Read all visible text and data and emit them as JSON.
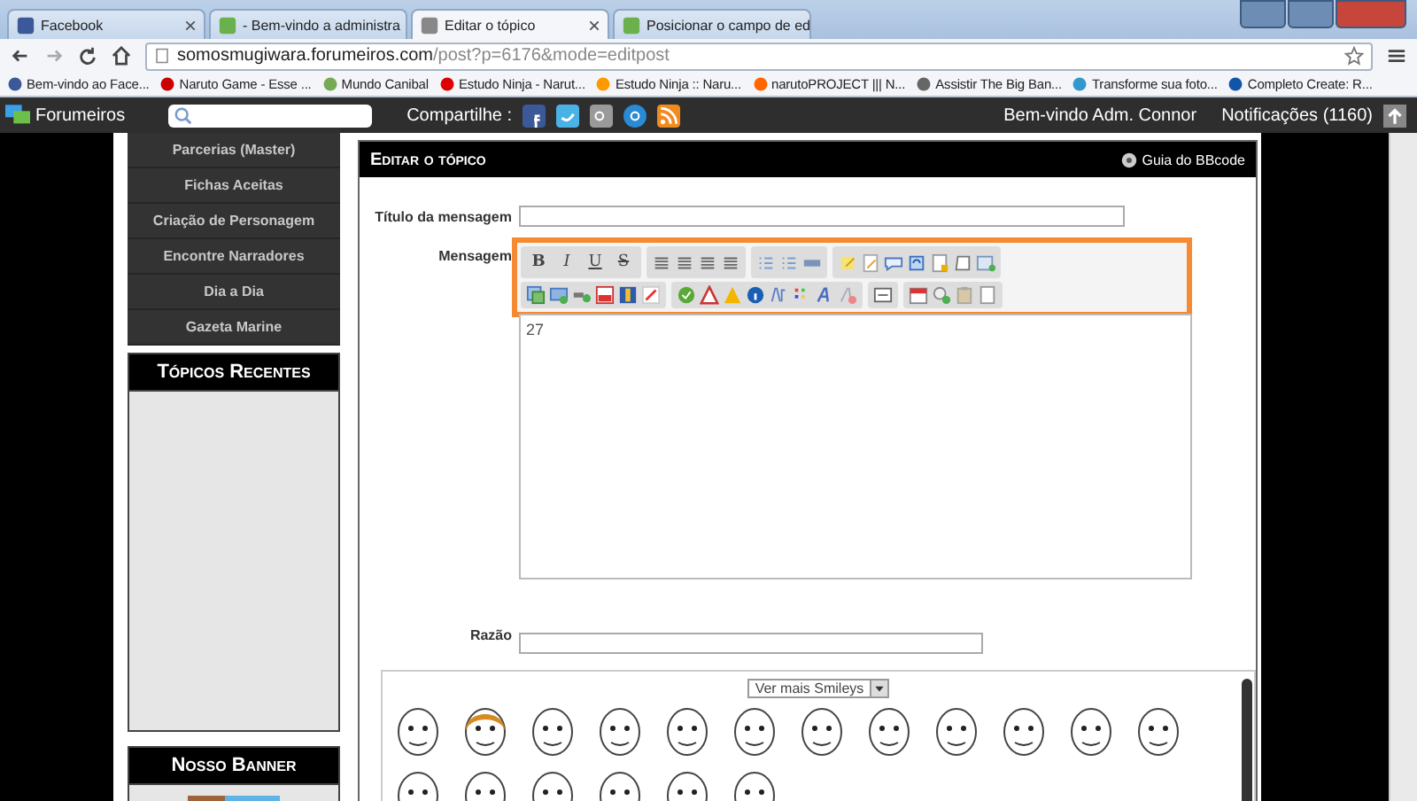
{
  "browser": {
    "tabs": [
      {
        "title": "Facebook",
        "selected": false
      },
      {
        "title": "- Bem-vindo a administra",
        "selected": false
      },
      {
        "title": "Editar o tópico",
        "selected": true
      },
      {
        "title": "Posicionar o campo de ed",
        "selected": false
      }
    ],
    "address": {
      "host": "somosmugiwara.forumeiros.com",
      "path": "/post?p=6176&mode=editpost"
    },
    "bookmarks": [
      "Bem-vindo ao Face...",
      "Naruto Game - Esse ...",
      "Mundo Canibal",
      "Estudo Ninja - Narut...",
      "Estudo Ninja :: Naru...",
      "narutoPROJECT ||| N...",
      "Assistir The Big Ban...",
      "Transforme sua foto...",
      "Completo Create: R..."
    ]
  },
  "topbar": {
    "brand": "Forumeiros",
    "share_label": "Compartilhe :",
    "welcome": "Bem-vindo Adm. Connor",
    "notifications": "Notificações (1160)"
  },
  "sidebar": {
    "menu": [
      "Parcerias (Master)",
      "Fichas Aceitas",
      "Criação de Personagem",
      "Encontre Narradores",
      "Dia a Dia",
      "Gazeta Marine"
    ],
    "widgets": [
      {
        "title": "Tópicos Recentes",
        "kind": "empty"
      },
      {
        "title": "Nosso Banner",
        "kind": "banner"
      }
    ]
  },
  "editor": {
    "title": "Editar o tópico",
    "help_link": "Guia do BBcode",
    "subject_label": "Título da mensagem",
    "message_label": "Mensagem",
    "format_buttons": [
      "B",
      "I",
      "U",
      "S"
    ],
    "message": "27",
    "reason_label": "Razão",
    "smileys_select": "Ver mais Smileys"
  }
}
